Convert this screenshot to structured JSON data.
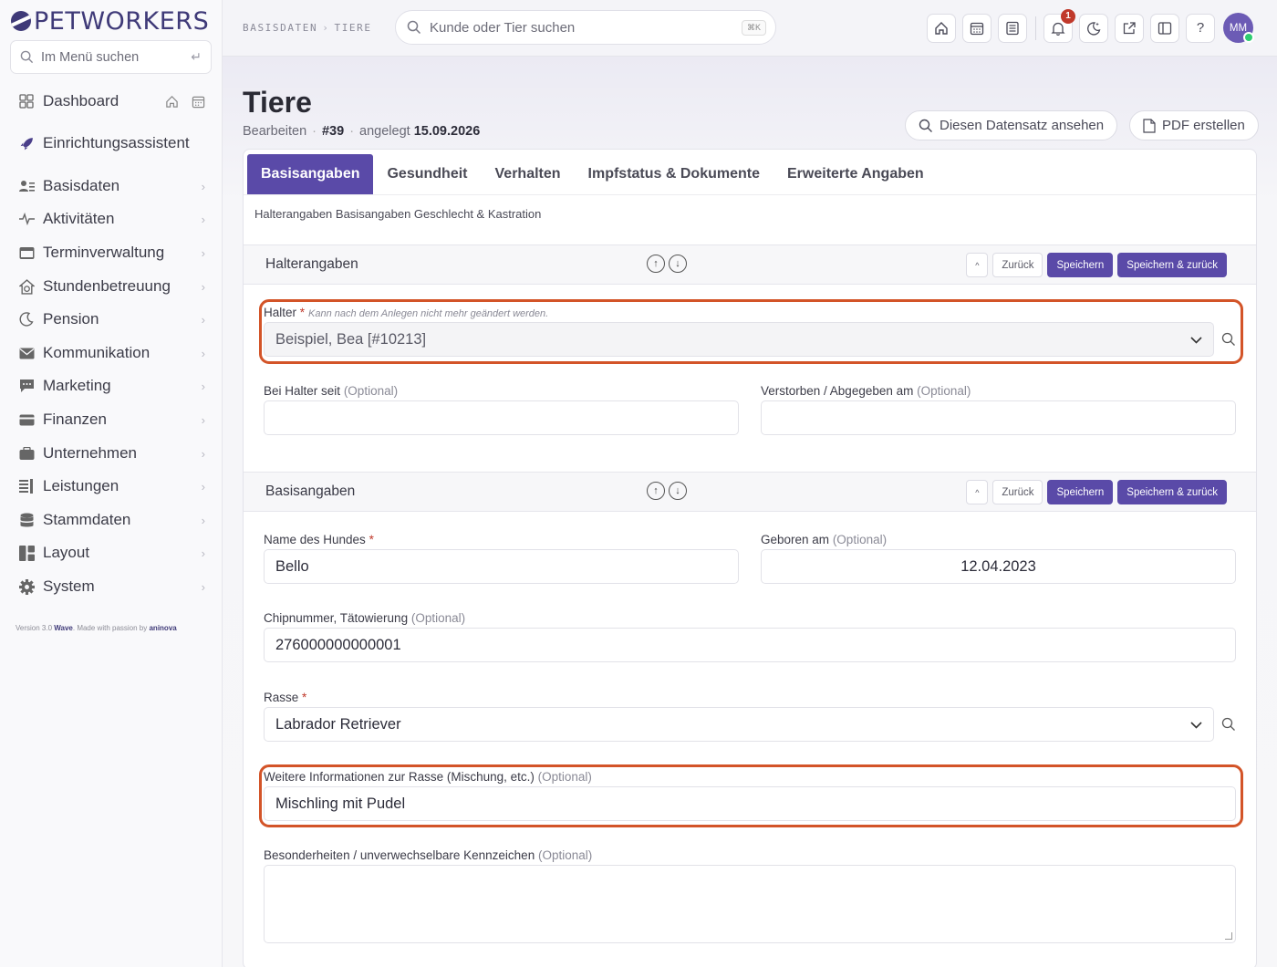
{
  "brand": {
    "name": "PETWORKERS"
  },
  "sidebar": {
    "search_placeholder": "Im Menü suchen",
    "items": [
      {
        "label": "Dashboard",
        "icon": "grid-icon"
      },
      {
        "label": "Einrichtungsassistent",
        "icon": "rocket-icon"
      },
      {
        "label": "Basisdaten",
        "icon": "users-list-icon"
      },
      {
        "label": "Aktivitäten",
        "icon": "activity-icon"
      },
      {
        "label": "Terminverwaltung",
        "icon": "calendar-icon"
      },
      {
        "label": "Stundenbetreuung",
        "icon": "clock-home-icon"
      },
      {
        "label": "Pension",
        "icon": "moon-icon"
      },
      {
        "label": "Kommunikation",
        "icon": "envelope-icon"
      },
      {
        "label": "Marketing",
        "icon": "chat-icon"
      },
      {
        "label": "Finanzen",
        "icon": "credit-card-icon"
      },
      {
        "label": "Unternehmen",
        "icon": "briefcase-icon"
      },
      {
        "label": "Leistungen",
        "icon": "list-icon"
      },
      {
        "label": "Stammdaten",
        "icon": "database-icon"
      },
      {
        "label": "Layout",
        "icon": "layout-icon"
      },
      {
        "label": "System",
        "icon": "gear-icon"
      }
    ],
    "version_prefix": "Version 3.0",
    "version_product": "Wave",
    "version_mid": ". Made with passion by",
    "version_company": "aninova"
  },
  "topbar": {
    "breadcrumb": [
      "BASISDATEN",
      "TIERE"
    ],
    "search_placeholder": "Kunde oder Tier suchen",
    "search_shortcut": "⌘K",
    "notification_count": "1",
    "avatar_initials": "MM",
    "help_label": "?"
  },
  "page": {
    "title": "Tiere",
    "mode": "Bearbeiten",
    "record_id": "#39",
    "created_label": "angelegt",
    "created_date": "15.09.2026",
    "view_button": "Diesen Datensatz ansehen",
    "pdf_button": "PDF erstellen"
  },
  "tabs": [
    {
      "label": "Basisangaben",
      "active": true
    },
    {
      "label": "Gesundheit",
      "active": false
    },
    {
      "label": "Verhalten",
      "active": false
    },
    {
      "label": "Impfstatus & Dokumente",
      "active": false
    },
    {
      "label": "Erweiterte Angaben",
      "active": false
    }
  ],
  "sub_crumbs": "Halterangaben Basisangaben Geschlecht & Kastration",
  "section_buttons": {
    "back": "Zurück",
    "save": "Speichern",
    "save_back": "Speichern & zurück",
    "collapse": "^"
  },
  "sections": {
    "halter": {
      "title": "Halterangaben",
      "owner_label": "Halter",
      "owner_hint": "Kann nach dem Anlegen nicht mehr geändert werden.",
      "owner_value": "Beispiel, Bea [#10213]",
      "since_label": "Bei Halter seit",
      "deceased_label": "Verstorben / Abgegeben am"
    },
    "basis": {
      "title": "Basisangaben",
      "name_label": "Name des Hundes",
      "name_value": "Bello",
      "born_label": "Geboren am",
      "born_value": "12.04.2023",
      "chip_label": "Chipnummer, Tätowierung",
      "chip_value": "276000000000001",
      "breed_label": "Rasse",
      "breed_value": "Labrador Retriever",
      "breed_info_label": "Weitere Informationen zur Rasse (Mischung, etc.)",
      "breed_info_value": "Mischling mit Pudel",
      "features_label": "Besonderheiten / unverwechselbare Kennzeichen"
    }
  },
  "optional_text": "(Optional)",
  "required_mark": "*",
  "colors": {
    "primary": "#5a4aa8",
    "highlight": "#d35428",
    "brand": "#3f3a78",
    "badge": "#c0392b"
  }
}
